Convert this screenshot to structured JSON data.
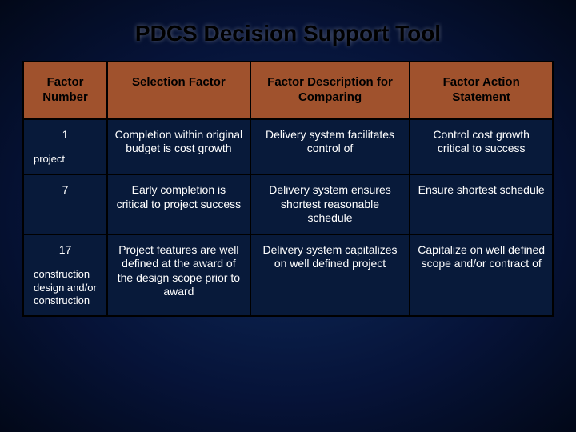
{
  "title": "PDCS Decision Support Tool",
  "headers": [
    "Factor Number",
    "Selection Factor",
    "Factor Description for Comparing",
    "Factor Action Statement"
  ],
  "rows": [
    {
      "num": "1",
      "sub": "project",
      "selection": "Completion within original budget is cost growth",
      "description": "Delivery system facilitates control of",
      "action": "Control cost growth critical to success"
    },
    {
      "num": "7",
      "sub": "",
      "selection": "Early completion is critical to project success",
      "description": "Delivery system ensures shortest reasonable schedule",
      "action": "Ensure shortest schedule"
    },
    {
      "num": "17",
      "sub": "construction design and/or construction",
      "selection": "Project features are well defined at the award of the design scope prior to award",
      "description": "Delivery system capitalizes on well defined project",
      "action": "Capitalize on well defined scope and/or contract of"
    }
  ]
}
